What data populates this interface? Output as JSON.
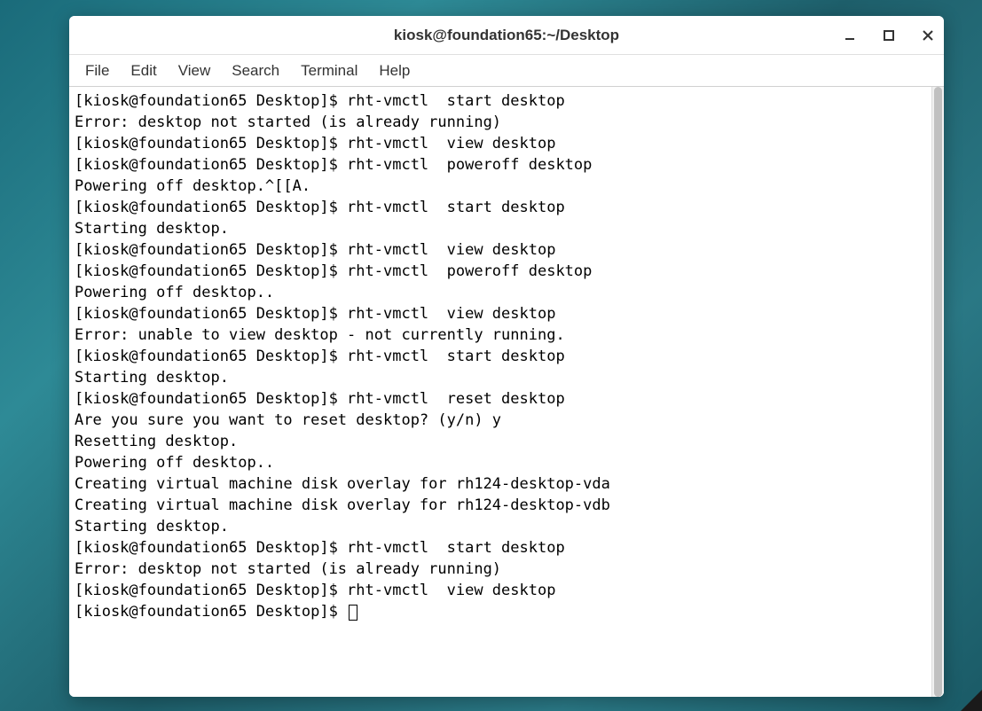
{
  "window": {
    "title": "kiosk@foundation65:~/Desktop"
  },
  "menu": {
    "file": "File",
    "edit": "Edit",
    "view": "View",
    "search": "Search",
    "terminal": "Terminal",
    "help": "Help"
  },
  "terminal": {
    "lines": [
      "[kiosk@foundation65 Desktop]$ rht-vmctl  start desktop",
      "Error: desktop not started (is already running)",
      "[kiosk@foundation65 Desktop]$ rht-vmctl  view desktop",
      "[kiosk@foundation65 Desktop]$ rht-vmctl  poweroff desktop",
      "Powering off desktop.^[[A.",
      "[kiosk@foundation65 Desktop]$ rht-vmctl  start desktop",
      "Starting desktop.",
      "[kiosk@foundation65 Desktop]$ rht-vmctl  view desktop",
      "[kiosk@foundation65 Desktop]$ rht-vmctl  poweroff desktop",
      "Powering off desktop..",
      "[kiosk@foundation65 Desktop]$ rht-vmctl  view desktop",
      "Error: unable to view desktop - not currently running.",
      "[kiosk@foundation65 Desktop]$ rht-vmctl  start desktop",
      "Starting desktop.",
      "[kiosk@foundation65 Desktop]$ rht-vmctl  reset desktop",
      "Are you sure you want to reset desktop? (y/n) y",
      "Resetting desktop.",
      "Powering off desktop..",
      "Creating virtual machine disk overlay for rh124-desktop-vda",
      "Creating virtual machine disk overlay for rh124-desktop-vdb",
      "Starting desktop.",
      "[kiosk@foundation65 Desktop]$ rht-vmctl  start desktop",
      "Error: desktop not started (is already running)",
      "[kiosk@foundation65 Desktop]$ rht-vmctl  view desktop",
      "[kiosk@foundation65 Desktop]$ "
    ]
  }
}
